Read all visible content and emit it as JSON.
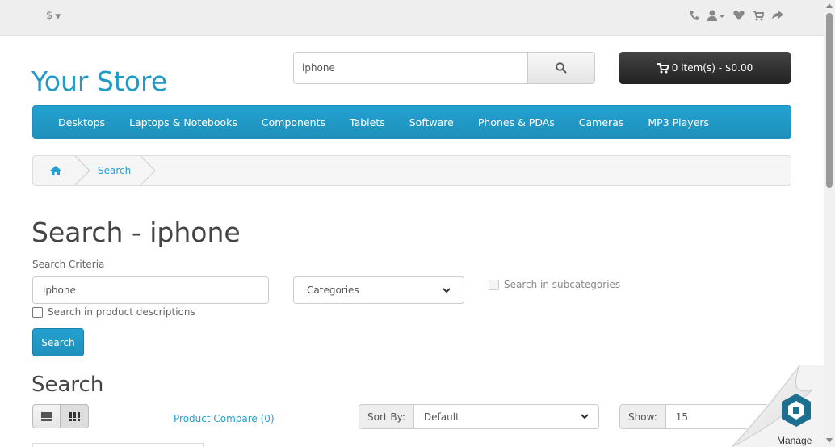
{
  "topbar": {
    "currency": "$",
    "icons": [
      "phone-icon",
      "user-icon",
      "heart-icon",
      "cart-icon",
      "share-icon"
    ]
  },
  "header": {
    "logo": "Your Store",
    "search_value": "iphone",
    "cart_label": "0 item(s) - $0.00"
  },
  "menu": {
    "items": [
      "Desktops",
      "Laptops & Notebooks",
      "Components",
      "Tablets",
      "Software",
      "Phones & PDAs",
      "Cameras",
      "MP3 Players"
    ]
  },
  "breadcrumb": {
    "current": "Search"
  },
  "content": {
    "title": "Search - iphone",
    "criteria_label": "Search Criteria",
    "keyword_value": "iphone",
    "category_selected": "Categories",
    "subcategories_label": "Search in subcategories",
    "description_label": "Search in product descriptions",
    "search_button": "Search",
    "section_title": "Search",
    "compare_link": "Product Compare (0)",
    "sort_label": "Sort By:",
    "sort_selected": "Default",
    "show_label": "Show:",
    "show_selected": "15"
  },
  "widget": {
    "manage_label": "Manage"
  },
  "colors": {
    "brand": "#229ac8",
    "menu_bg": "#23a1d1",
    "cart_bg": "#303030"
  }
}
